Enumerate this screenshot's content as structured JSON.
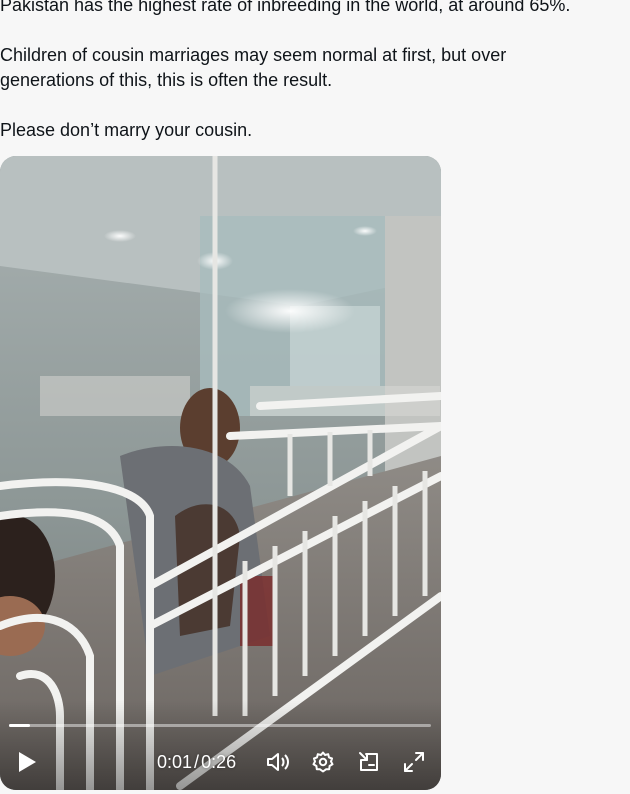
{
  "post": {
    "line1": "Pakistan has the highest rate of inbreeding in the world, at around 65%.",
    "line2a": "Children of cousin marriages may seem normal at first, but over",
    "line2b": "generations of this, this is often the result.",
    "line3": "Please don’t marry your cousin."
  },
  "video": {
    "current_time": "0:01",
    "duration": "0:26",
    "separator": "/",
    "progress_fraction": 0.05
  },
  "icons": {
    "play": "play-icon",
    "volume": "volume-icon",
    "settings": "gear-icon",
    "pip": "picture-in-picture-icon",
    "fullscreen": "fullscreen-icon"
  }
}
